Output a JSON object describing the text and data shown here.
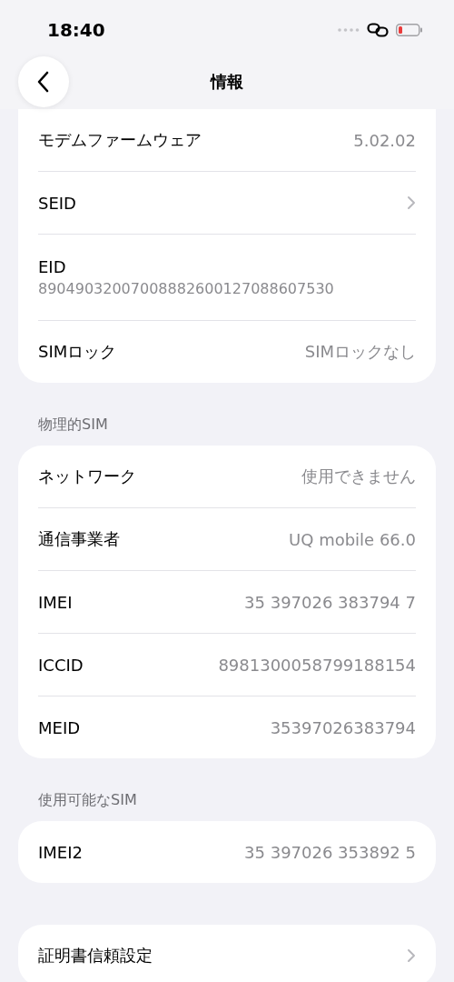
{
  "status_bar": {
    "time": "18:40"
  },
  "nav": {
    "title": "情報"
  },
  "sections": [
    {
      "rows": [
        {
          "kind": "value",
          "label": "モデムファームウェア",
          "value": "5.02.02"
        },
        {
          "kind": "chevron",
          "label": "SEID"
        },
        {
          "kind": "stacked",
          "label": "EID",
          "value": "89049032007008882600127088607530"
        },
        {
          "kind": "value",
          "label": "SIMロック",
          "value": "SIMロックなし"
        }
      ]
    },
    {
      "header": "物理的SIM",
      "rows": [
        {
          "kind": "value",
          "label": "ネットワーク",
          "value": "使用できません"
        },
        {
          "kind": "value",
          "label": "通信事業者",
          "value": "UQ mobile 66.0"
        },
        {
          "kind": "value",
          "label": "IMEI",
          "value": "35 397026 383794 7"
        },
        {
          "kind": "value",
          "label": "ICCID",
          "value": "8981300058799188154"
        },
        {
          "kind": "value",
          "label": "MEID",
          "value": "35397026383794"
        }
      ]
    },
    {
      "header": "使用可能なSIM",
      "rows": [
        {
          "kind": "value",
          "label": "IMEI2",
          "value": "35 397026 353892 5"
        }
      ]
    },
    {
      "rows": [
        {
          "kind": "chevron",
          "label": "証明書信頼設定"
        }
      ]
    }
  ]
}
